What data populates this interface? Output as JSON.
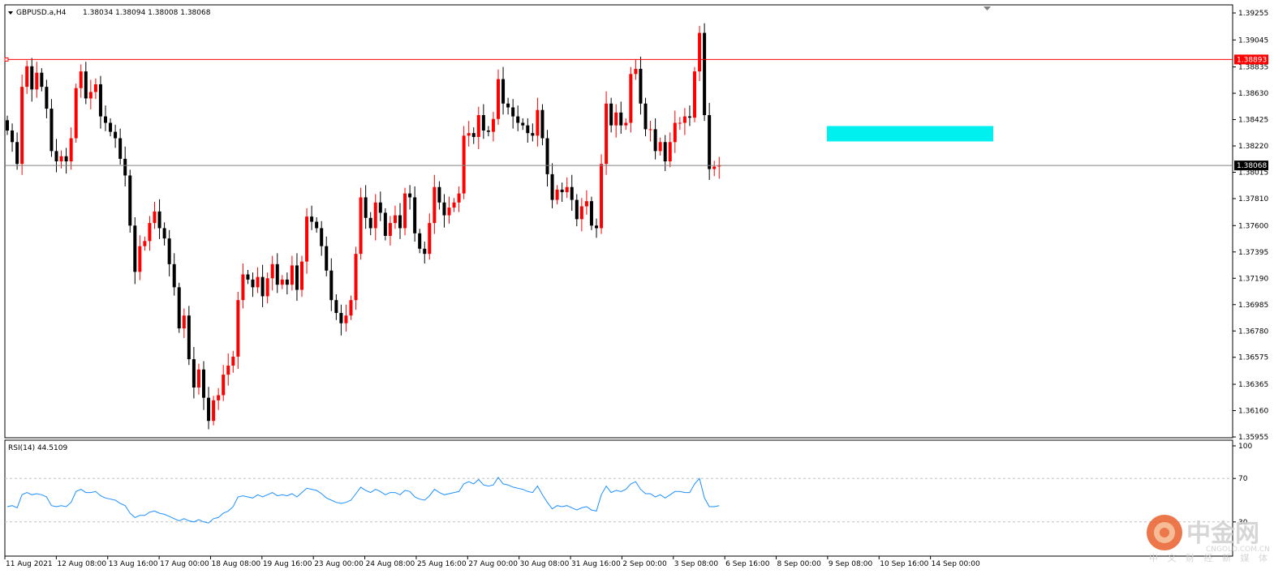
{
  "header": {
    "symbol": "GBPUSD.a,H4",
    "ohlc": "1.38034 1.38094 1.38008 1.38068"
  },
  "rsi_label": "RSI(14) 44.5109",
  "watermark": {
    "brand": "中金网",
    "domain": "CNGOLD.COM.CN",
    "slogan": "中 文 财 经 新 媒 体"
  },
  "colors": {
    "bull": "#ff0000",
    "bear": "#000000",
    "level_line": "#ff0000",
    "zone": "#00f0f0",
    "rsi_line": "#1e90ff",
    "current_price_tag": "#000000",
    "level_tag": "#ff0000"
  },
  "chart_data": [
    {
      "type": "candlestick",
      "symbol": "GBPUSD.a",
      "timeframe": "H4",
      "ylim": [
        1.35955,
        1.39255
      ],
      "y_ticks": [
        "1.39255",
        "1.39045",
        "1.38835",
        "1.38630",
        "1.38425",
        "1.38220",
        "1.38015",
        "1.37810",
        "1.37600",
        "1.37395",
        "1.37190",
        "1.36985",
        "1.36780",
        "1.36575",
        "1.36365",
        "1.36160",
        "1.35955"
      ],
      "x_ticks": [
        "11 Aug 2021",
        "12 Aug 08:00",
        "13 Aug 16:00",
        "17 Aug 00:00",
        "18 Aug 08:00",
        "19 Aug 16:00",
        "23 Aug 00:00",
        "24 Aug 08:00",
        "25 Aug 16:00",
        "27 Aug 00:00",
        "30 Aug 08:00",
        "31 Aug 16:00",
        "2 Sep 00:00",
        "3 Sep 08:00",
        "6 Sep 16:00",
        "8 Sep 00:00",
        "9 Sep 08:00",
        "10 Sep 16:00",
        "14 Sep 00:00"
      ],
      "resistance_level": "1.38893",
      "current_price": "1.38068",
      "zone": {
        "from": 1.38255,
        "to": 1.38375
      },
      "closes": [
        1.3834,
        1.3825,
        1.3808,
        1.3868,
        1.3884,
        1.3866,
        1.3879,
        1.3868,
        1.3851,
        1.3818,
        1.381,
        1.3814,
        1.381,
        1.3828,
        1.3867,
        1.388,
        1.3859,
        1.3864,
        1.387,
        1.3845,
        1.384,
        1.3833,
        1.3828,
        1.3812,
        1.3799,
        1.376,
        1.3724,
        1.3744,
        1.3748,
        1.3762,
        1.3771,
        1.3758,
        1.375,
        1.373,
        1.3712,
        1.368,
        1.369,
        1.3656,
        1.3634,
        1.3648,
        1.3626,
        1.3608,
        1.3624,
        1.3628,
        1.3644,
        1.3651,
        1.3658,
        1.3702,
        1.3722,
        1.3718,
        1.3712,
        1.372,
        1.3705,
        1.3719,
        1.373,
        1.3714,
        1.3718,
        1.3714,
        1.3729,
        1.371,
        1.3732,
        1.3767,
        1.3763,
        1.3758,
        1.3744,
        1.3725,
        1.3702,
        1.3692,
        1.3684,
        1.369,
        1.3702,
        1.3738,
        1.3782,
        1.3766,
        1.3758,
        1.3778,
        1.377,
        1.3752,
        1.3762,
        1.3768,
        1.3758,
        1.3785,
        1.3782,
        1.3754,
        1.3742,
        1.3738,
        1.3762,
        1.379,
        1.3778,
        1.3768,
        1.3774,
        1.3778,
        1.3785,
        1.383,
        1.3832,
        1.3829,
        1.3846,
        1.3834,
        1.3833,
        1.3843,
        1.3874,
        1.3855,
        1.3852,
        1.3845,
        1.384,
        1.3838,
        1.3832,
        1.383,
        1.385,
        1.3828,
        1.38,
        1.378,
        1.3788,
        1.3786,
        1.379,
        1.378,
        1.3765,
        1.3775,
        1.3779,
        1.376,
        1.3758,
        1.3808,
        1.3855,
        1.3838,
        1.3848,
        1.3838,
        1.384,
        1.3878,
        1.3882,
        1.3855,
        1.3835,
        1.3835,
        1.3818,
        1.3825,
        1.381,
        1.3825,
        1.384,
        1.384,
        1.3845,
        1.3844,
        1.388,
        1.391,
        1.3846,
        1.3804,
        1.3806,
        1.3807
      ],
      "rsi": {
        "period": 14,
        "value": 44.5109,
        "levels": [
          30,
          70
        ],
        "ylim": [
          0,
          100
        ],
        "values": [
          44,
          45,
          43,
          55,
          57,
          55,
          56,
          55,
          53,
          45,
          44,
          45,
          44,
          48,
          58,
          60,
          57,
          57,
          58,
          54,
          52,
          51,
          50,
          47,
          45,
          38,
          34,
          36,
          36,
          39,
          40,
          38,
          37,
          35,
          33,
          31,
          33,
          31,
          30,
          32,
          30,
          29,
          33,
          34,
          38,
          40,
          44,
          53,
          54,
          53,
          52,
          55,
          53,
          55,
          57,
          54,
          55,
          54,
          56,
          53,
          57,
          61,
          60,
          59,
          56,
          52,
          50,
          48,
          47,
          48,
          50,
          56,
          62,
          59,
          57,
          60,
          58,
          55,
          57,
          57,
          55,
          59,
          58,
          53,
          51,
          50,
          54,
          60,
          57,
          55,
          56,
          57,
          58,
          65,
          67,
          65,
          69,
          64,
          63,
          64,
          71,
          65,
          64,
          62,
          61,
          60,
          58,
          57,
          63,
          55,
          48,
          42,
          45,
          44,
          45,
          43,
          41,
          43,
          44,
          41,
          40,
          55,
          63,
          57,
          59,
          58,
          60,
          65,
          67,
          60,
          56,
          56,
          53,
          55,
          52,
          55,
          58,
          58,
          57,
          57,
          65,
          70,
          52,
          44,
          44,
          45
        ]
      }
    }
  ]
}
